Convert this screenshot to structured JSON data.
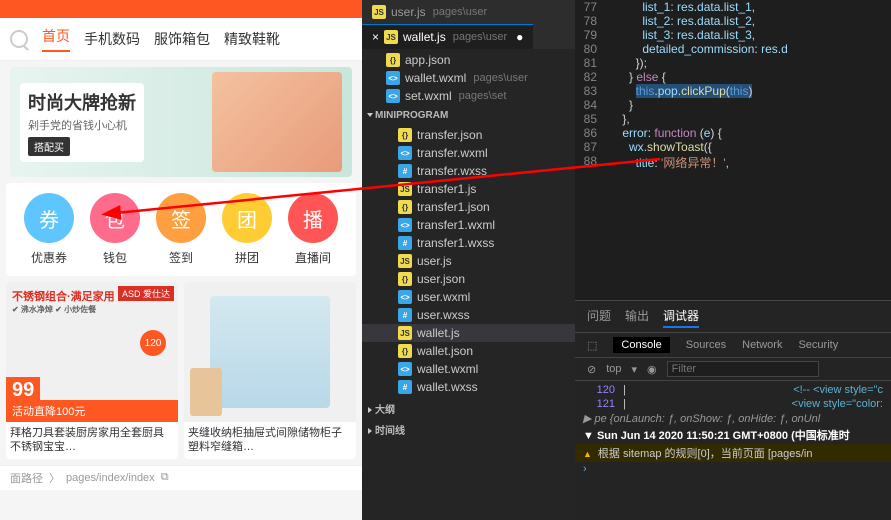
{
  "preview": {
    "nav": {
      "items": [
        "首页",
        "手机数码",
        "服饰箱包",
        "精致鞋靴"
      ],
      "active": 0
    },
    "banner": {
      "title": "时尚大牌抢新",
      "subtitle": "剁手党的省钱小心机",
      "button": "搭配买"
    },
    "quick": [
      {
        "icon": "券",
        "label": "优惠券"
      },
      {
        "icon": "包",
        "label": "钱包"
      },
      {
        "icon": "签",
        "label": "签到"
      },
      {
        "icon": "团",
        "label": "拼团"
      },
      {
        "icon": "播",
        "label": "直播间"
      }
    ],
    "products": [
      {
        "badge": "ASD 爱仕达",
        "head": "不锈钢组合·满足家用",
        "sub": "✔ 沸水净焯  ✔ 小炒佐餐",
        "price_label": "120",
        "promo_price": "99",
        "promo": "活动直降100元",
        "title": "拜格刀具套装厨房家用全套厨具不锈钢宝宝…"
      },
      {
        "title": "夹缝收纳柜抽屉式间隙储物柜子塑料窄缝箱…"
      }
    ],
    "footer": {
      "path_label": "面路径",
      "path": "pages/index/index"
    }
  },
  "files": {
    "open_tabs": [
      {
        "name": "user.js",
        "dir": "pages\\user",
        "active": false
      },
      {
        "name": "wallet.js",
        "dir": "pages\\user",
        "active": true,
        "modified": true
      }
    ],
    "tree_top": [
      {
        "name": "app.json",
        "type": "json"
      },
      {
        "name": "wallet.wxml",
        "type": "wxml",
        "dir": "pages\\user"
      },
      {
        "name": "set.wxml",
        "type": "wxml",
        "dir": "pages\\set"
      }
    ],
    "section": "MINIPROGRAM",
    "tree": [
      {
        "name": "transfer.json",
        "type": "json"
      },
      {
        "name": "transfer.wxml",
        "type": "wxml"
      },
      {
        "name": "transfer.wxss",
        "type": "wxss"
      },
      {
        "name": "transfer1.js",
        "type": "js"
      },
      {
        "name": "transfer1.json",
        "type": "json"
      },
      {
        "name": "transfer1.wxml",
        "type": "wxml"
      },
      {
        "name": "transfer1.wxss",
        "type": "wxss"
      },
      {
        "name": "user.js",
        "type": "js"
      },
      {
        "name": "user.json",
        "type": "json"
      },
      {
        "name": "user.wxml",
        "type": "wxml"
      },
      {
        "name": "user.wxss",
        "type": "wxss"
      },
      {
        "name": "wallet.js",
        "type": "js",
        "selected": true
      },
      {
        "name": "wallet.json",
        "type": "json"
      },
      {
        "name": "wallet.wxml",
        "type": "wxml"
      },
      {
        "name": "wallet.wxss",
        "type": "wxss"
      }
    ],
    "bottom": [
      "大纲",
      "时间线"
    ]
  },
  "code": {
    "lines": [
      {
        "n": 77,
        "html": "          <span class='t-prop'>list_1</span>: <span class='t-var'>res</span>.<span class='t-var'>data</span>.<span class='t-var'>list_1</span>,"
      },
      {
        "n": 78,
        "html": "          <span class='t-prop'>list_2</span>: <span class='t-var'>res</span>.<span class='t-var'>data</span>.<span class='t-var'>list_2</span>,"
      },
      {
        "n": 79,
        "html": "          <span class='t-prop'>list_3</span>: <span class='t-var'>res</span>.<span class='t-var'>data</span>.<span class='t-var'>list_3</span>,"
      },
      {
        "n": 80,
        "html": "          <span class='t-prop'>detailed_commission</span>: <span class='t-var'>res</span>.<span class='t-var'>d</span>"
      },
      {
        "n": 81,
        "html": "        });"
      },
      {
        "n": 82,
        "html": "      } <span class='t-kw'>else</span> {"
      },
      {
        "n": 83,
        "html": "        <span class='hl'><span class='t-this'>this</span>.<span class='t-var'>pop</span>.<span class='t-func'>clickPup</span>(<span class='t-this'>this</span>)</span>"
      },
      {
        "n": 84,
        "html": "      }"
      },
      {
        "n": 85,
        "html": "    },"
      },
      {
        "n": 86,
        "html": "    <span class='t-prop'>error</span>: <span class='t-kw'>function</span> (<span class='t-var'>e</span>) {"
      },
      {
        "n": 87,
        "html": "      <span class='t-var'>wx</span>.<span class='t-func'>showToast</span>({"
      },
      {
        "n": 88,
        "html": "        <span class='t-prop'>title</span>: <span class='t-str'>'网络异常！'</span>,"
      }
    ]
  },
  "devtools": {
    "tabs": [
      "问题",
      "输出",
      "调试器"
    ],
    "active_tab": 2,
    "subtabs": [
      "Console",
      "Sources",
      "Network",
      "Security"
    ],
    "active_sub": 0,
    "filter_top": "top",
    "filter_placeholder": "Filter",
    "console": {
      "nums": [
        "120",
        "121"
      ],
      "html1": "<!-- <view style=\"c",
      "html2": "<view style=\"color:",
      "obj": "▶ pe {onLaunch: ƒ, onShow: ƒ, onHide: ƒ, onUnl",
      "time": "▼ Sun Jun 14 2020 11:50:21 GMT+0800 (中国标准时",
      "warn": "根据 sitemap 的规则[0]，当前页面 [pages/in",
      "prompt": "›"
    }
  }
}
